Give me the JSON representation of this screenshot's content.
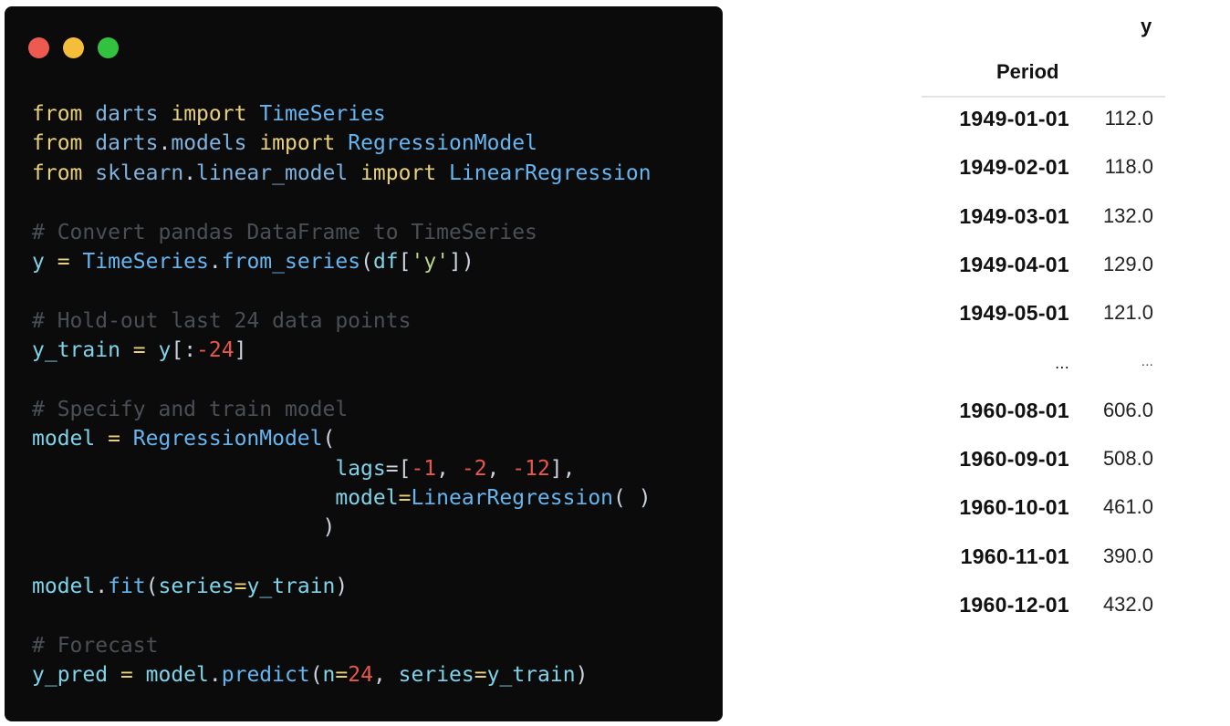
{
  "window_controls": {
    "close_color": "#ed5a50",
    "minimize_color": "#f4bd3a",
    "maximize_color": "#33c23f"
  },
  "code_lines": [
    [
      {
        "t": "from",
        "c": "kw"
      },
      {
        "t": " ",
        "c": "pun"
      },
      {
        "t": "darts",
        "c": "mod"
      },
      {
        "t": " ",
        "c": "pun"
      },
      {
        "t": "import",
        "c": "kw"
      },
      {
        "t": " ",
        "c": "pun"
      },
      {
        "t": "TimeSeries",
        "c": "cls"
      }
    ],
    [
      {
        "t": "from",
        "c": "kw"
      },
      {
        "t": " ",
        "c": "pun"
      },
      {
        "t": "darts",
        "c": "mod"
      },
      {
        "t": ".",
        "c": "pun"
      },
      {
        "t": "models",
        "c": "mod"
      },
      {
        "t": " ",
        "c": "pun"
      },
      {
        "t": "import",
        "c": "kw"
      },
      {
        "t": " ",
        "c": "pun"
      },
      {
        "t": "RegressionModel",
        "c": "cls"
      }
    ],
    [
      {
        "t": "from",
        "c": "kw"
      },
      {
        "t": " ",
        "c": "pun"
      },
      {
        "t": "sklearn",
        "c": "mod"
      },
      {
        "t": ".",
        "c": "pun"
      },
      {
        "t": "linear_model",
        "c": "mod"
      },
      {
        "t": " ",
        "c": "pun"
      },
      {
        "t": "import",
        "c": "kw"
      },
      {
        "t": " ",
        "c": "pun"
      },
      {
        "t": "LinearRegression",
        "c": "cls"
      }
    ],
    [],
    [
      {
        "t": "# Convert pandas DataFrame to TimeSeries",
        "c": "cmt"
      }
    ],
    [
      {
        "t": "y",
        "c": "var"
      },
      {
        "t": " = ",
        "c": "op"
      },
      {
        "t": "TimeSeries",
        "c": "cls"
      },
      {
        "t": ".",
        "c": "pun"
      },
      {
        "t": "from_series",
        "c": "fn"
      },
      {
        "t": "(",
        "c": "pun"
      },
      {
        "t": "df",
        "c": "var"
      },
      {
        "t": "[",
        "c": "pun"
      },
      {
        "t": "'y'",
        "c": "str"
      },
      {
        "t": "])",
        "c": "pun"
      }
    ],
    [],
    [
      {
        "t": "# Hold-out last 24 data points",
        "c": "cmt"
      }
    ],
    [
      {
        "t": "y_train",
        "c": "var"
      },
      {
        "t": " = ",
        "c": "op"
      },
      {
        "t": "y",
        "c": "var"
      },
      {
        "t": "[:",
        "c": "pun"
      },
      {
        "t": "-24",
        "c": "num"
      },
      {
        "t": "]",
        "c": "pun"
      }
    ],
    [],
    [
      {
        "t": "# Specify and train model",
        "c": "cmt"
      }
    ],
    [
      {
        "t": "model",
        "c": "var"
      },
      {
        "t": " = ",
        "c": "op"
      },
      {
        "t": "RegressionModel",
        "c": "cls"
      },
      {
        "t": "(",
        "c": "pun"
      }
    ],
    [
      {
        "t": "                        ",
        "c": "pun"
      },
      {
        "t": "lags",
        "c": "param"
      },
      {
        "t": "=[",
        "c": "pun"
      },
      {
        "t": "-1",
        "c": "num"
      },
      {
        "t": ", ",
        "c": "pun"
      },
      {
        "t": "-2",
        "c": "num"
      },
      {
        "t": ", ",
        "c": "pun"
      },
      {
        "t": "-12",
        "c": "num"
      },
      {
        "t": "],",
        "c": "pun"
      }
    ],
    [
      {
        "t": "                        ",
        "c": "pun"
      },
      {
        "t": "model",
        "c": "param"
      },
      {
        "t": "=",
        "c": "op"
      },
      {
        "t": "LinearRegression",
        "c": "cls"
      },
      {
        "t": "( )",
        "c": "pun"
      }
    ],
    [
      {
        "t": "                       ",
        "c": "pun"
      },
      {
        "t": ")",
        "c": "pun"
      }
    ],
    [],
    [
      {
        "t": "model",
        "c": "var"
      },
      {
        "t": ".",
        "c": "pun"
      },
      {
        "t": "fit",
        "c": "fn"
      },
      {
        "t": "(",
        "c": "pun"
      },
      {
        "t": "series",
        "c": "param"
      },
      {
        "t": "=",
        "c": "op"
      },
      {
        "t": "y_train",
        "c": "var"
      },
      {
        "t": ")",
        "c": "pun"
      }
    ],
    [],
    [
      {
        "t": "# Forecast",
        "c": "cmt"
      }
    ],
    [
      {
        "t": "y_pred",
        "c": "var"
      },
      {
        "t": " = ",
        "c": "op"
      },
      {
        "t": "model",
        "c": "var"
      },
      {
        "t": ".",
        "c": "pun"
      },
      {
        "t": "predict",
        "c": "fn"
      },
      {
        "t": "(",
        "c": "pun"
      },
      {
        "t": "n",
        "c": "param"
      },
      {
        "t": "=",
        "c": "op"
      },
      {
        "t": "24",
        "c": "num"
      },
      {
        "t": ", ",
        "c": "pun"
      },
      {
        "t": "series",
        "c": "param"
      },
      {
        "t": "=",
        "c": "op"
      },
      {
        "t": "y_train",
        "c": "var"
      },
      {
        "t": ")",
        "c": "pun"
      }
    ]
  ],
  "table": {
    "value_column": "y",
    "index_column": "Period",
    "rows": [
      {
        "date": "1949-01-01",
        "value": "112.0"
      },
      {
        "date": "1949-02-01",
        "value": "118.0"
      },
      {
        "date": "1949-03-01",
        "value": "132.0"
      },
      {
        "date": "1949-04-01",
        "value": "129.0"
      },
      {
        "date": "1949-05-01",
        "value": "121.0"
      },
      {
        "date": "...",
        "value": "..."
      },
      {
        "date": "1960-08-01",
        "value": "606.0"
      },
      {
        "date": "1960-09-01",
        "value": "508.0"
      },
      {
        "date": "1960-10-01",
        "value": "461.0"
      },
      {
        "date": "1960-11-01",
        "value": "390.0"
      },
      {
        "date": "1960-12-01",
        "value": "432.0"
      }
    ]
  }
}
